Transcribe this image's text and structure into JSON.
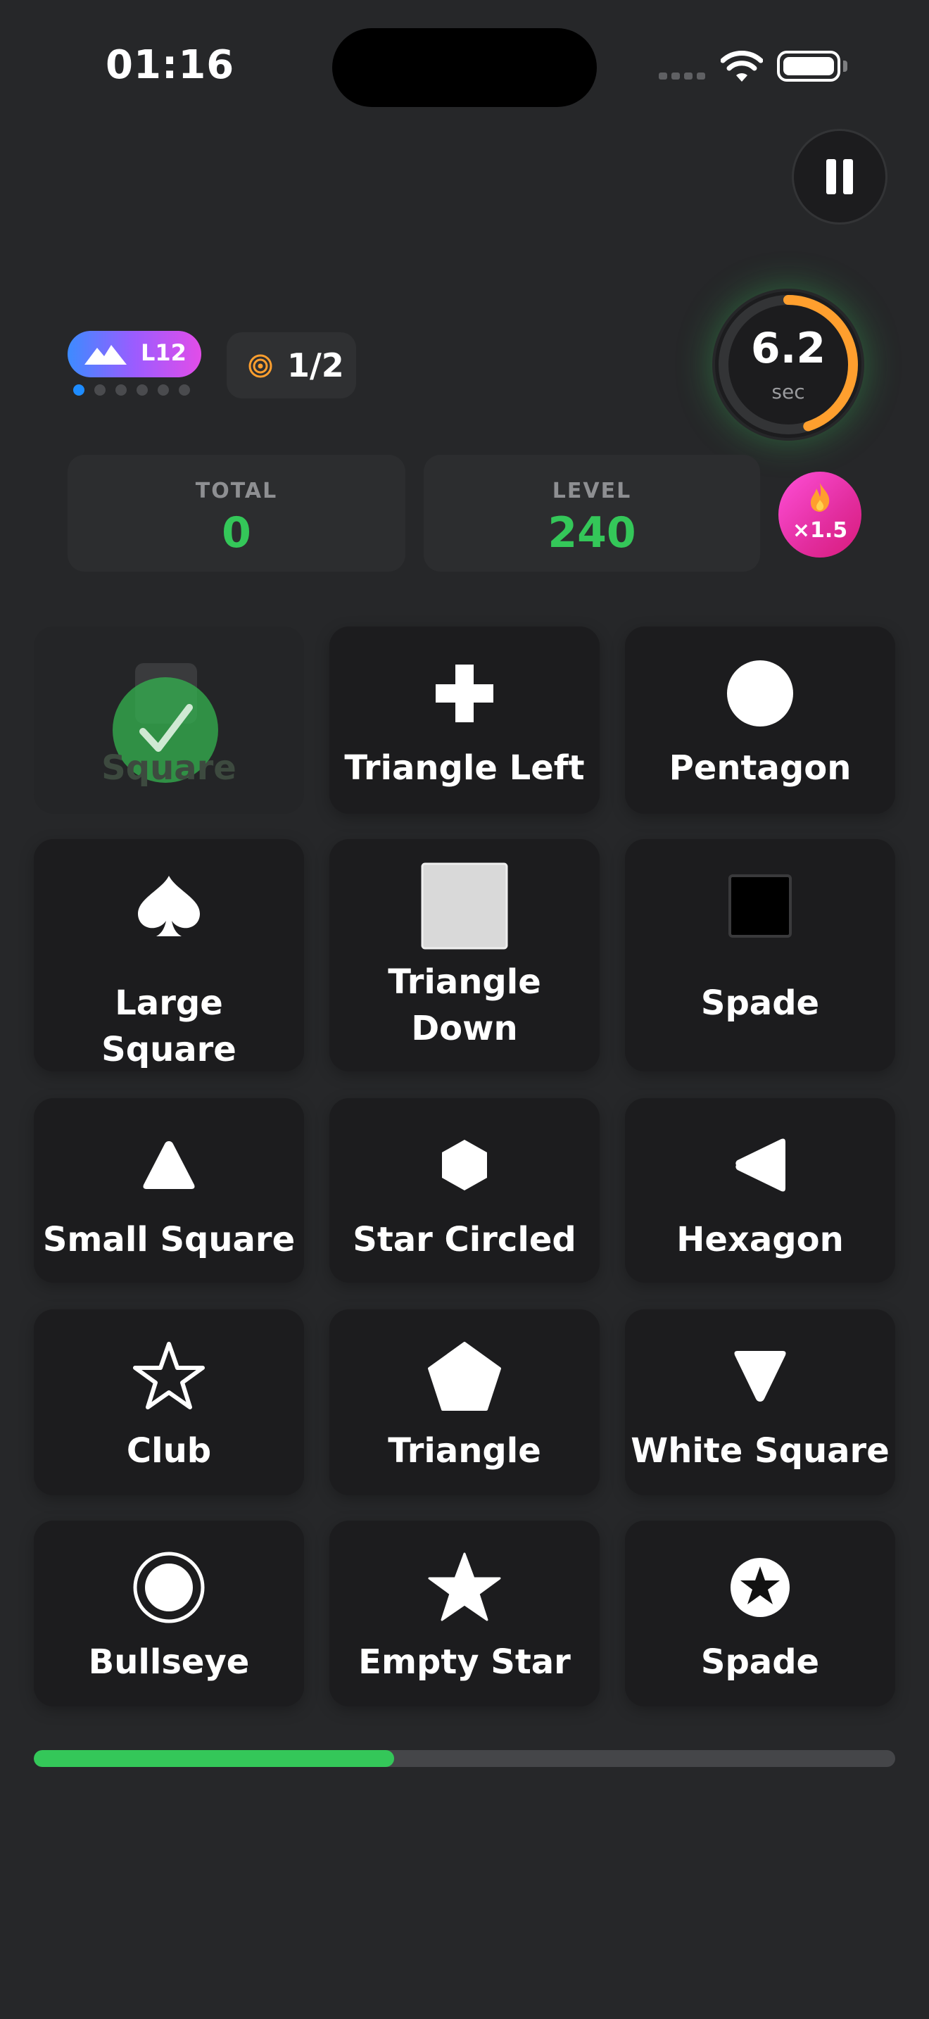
{
  "status_bar": {
    "time": "01:16"
  },
  "level": {
    "label": "L12",
    "dots_total": 6,
    "dots_active": 1
  },
  "target": {
    "count": "1/2"
  },
  "timer": {
    "value": "6.2",
    "unit": "sec",
    "remaining_fraction": 0.45
  },
  "scores": {
    "total_label": "TOTAL",
    "total_value": "0",
    "level_label": "LEVEL",
    "level_value": "240"
  },
  "multiplier": {
    "text": "×1.5"
  },
  "tiles": [
    {
      "label": "Square",
      "icon": "checkmark-icon",
      "completed": true
    },
    {
      "label": "Triangle Left",
      "icon": "plus-icon"
    },
    {
      "label": "Pentagon",
      "icon": "circle-icon"
    },
    {
      "label": "Large Square",
      "icon": "spade-icon"
    },
    {
      "label": "Triangle Down",
      "icon": "white-square-icon"
    },
    {
      "label": "Spade",
      "icon": "black-square-icon"
    },
    {
      "label": "Small Square",
      "icon": "triangle-up-icon"
    },
    {
      "label": "Star Circled",
      "icon": "hexagon-icon"
    },
    {
      "label": "Hexagon",
      "icon": "triangle-left-icon"
    },
    {
      "label": "Club",
      "icon": "empty-star-icon"
    },
    {
      "label": "Triangle",
      "icon": "pentagon-icon"
    },
    {
      "label": "White Square",
      "icon": "triangle-down-icon"
    },
    {
      "label": "Bullseye",
      "icon": "bullseye-icon"
    },
    {
      "label": "Empty Star",
      "icon": "star-icon"
    },
    {
      "label": "Spade",
      "icon": "star-circled-icon"
    }
  ],
  "progress": {
    "fraction": 0.418
  },
  "colors": {
    "background": "#262729",
    "accent_green": "#34c759",
    "timer_orange": "#ff9f2e",
    "multiplier_pink": "#e22d9e"
  }
}
